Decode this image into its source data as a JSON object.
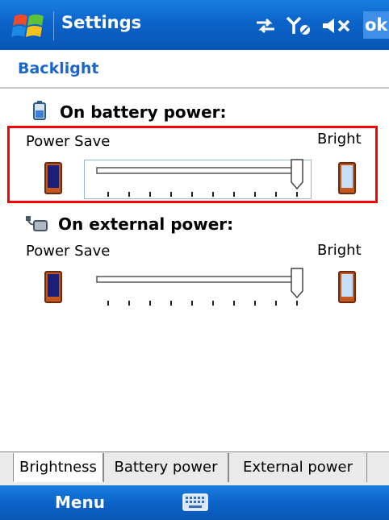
{
  "titlebar": {
    "title": "Settings",
    "ok_label": "ok"
  },
  "header": {
    "title": "Backlight"
  },
  "battery": {
    "title": "On battery power:",
    "min_label": "Power Save",
    "max_label": "Bright",
    "level": 1.0
  },
  "external": {
    "title": "On external power:",
    "min_label": "Power Save",
    "max_label": "Bright",
    "level": 1.0
  },
  "tabs": [
    {
      "label": "Brightness",
      "active": true
    },
    {
      "label": "Battery power",
      "active": false
    },
    {
      "label": "External power",
      "active": false
    }
  ],
  "softkeys": {
    "left": "Menu"
  },
  "colors": {
    "accent": "#0b63c9",
    "header_text": "#1b67c8",
    "highlight": "#ff0000"
  }
}
